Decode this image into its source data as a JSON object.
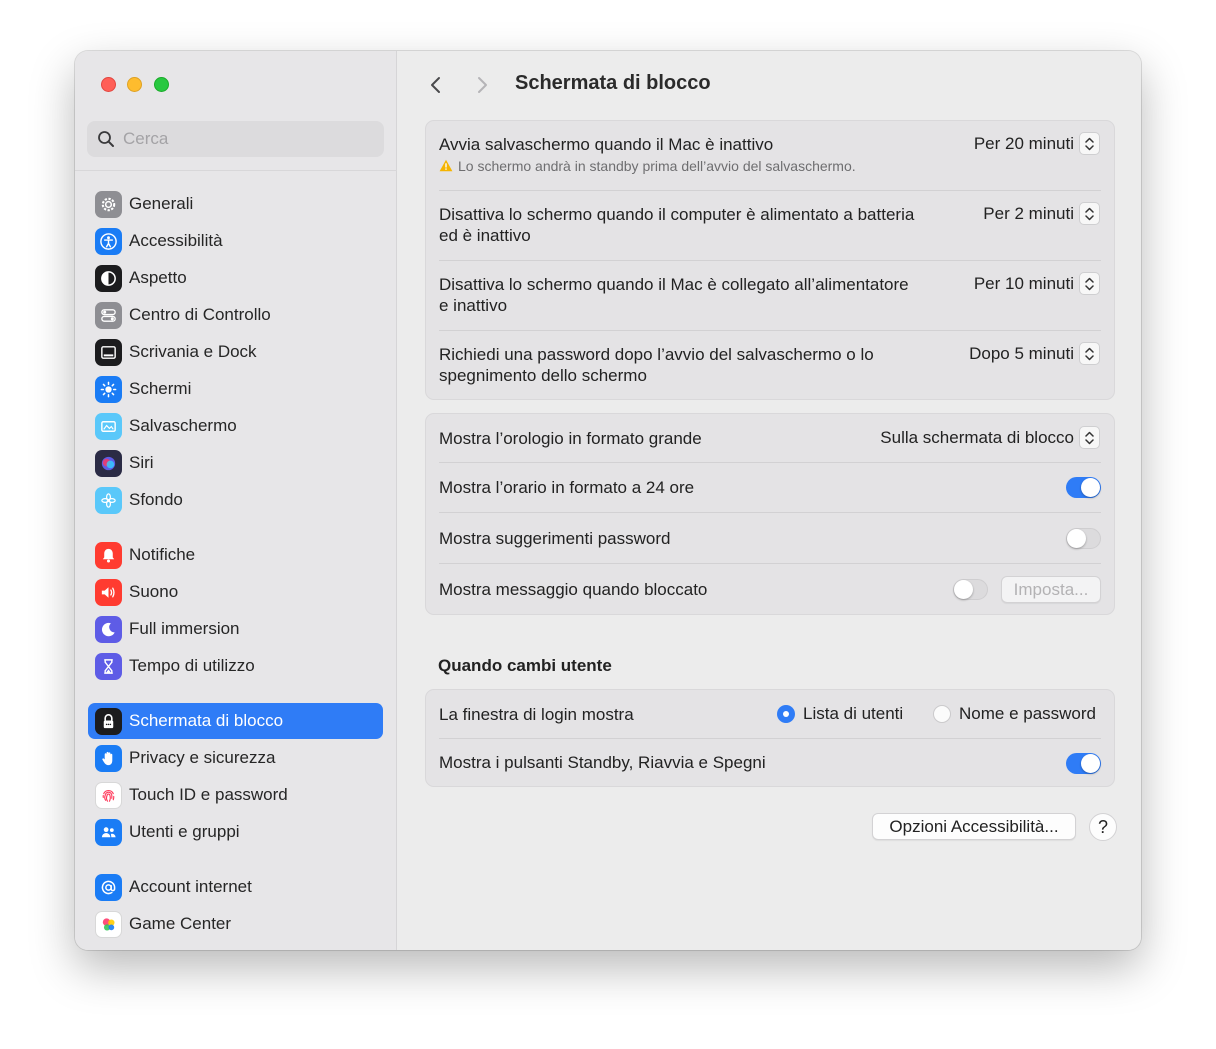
{
  "window": {
    "title": "Schermata di blocco"
  },
  "search": {
    "placeholder": "Cerca"
  },
  "sidebar": {
    "items": [
      {
        "label": "Generali",
        "icon": "gear-icon",
        "color": "#8e8e93"
      },
      {
        "label": "Accessibilità",
        "icon": "accessibility-icon",
        "color": "#1a7cf5"
      },
      {
        "label": "Aspetto",
        "icon": "appearance-icon",
        "color": "#1c1c1e"
      },
      {
        "label": "Centro di Controllo",
        "icon": "control-center-icon",
        "color": "#8e8e93"
      },
      {
        "label": "Scrivania e Dock",
        "icon": "dock-icon",
        "color": "#1c1c1e"
      },
      {
        "label": "Schermi",
        "icon": "sun-icon",
        "color": "#1a7cf5"
      },
      {
        "label": "Salvaschermo",
        "icon": "screensaver-icon",
        "color": "#5ac8fa"
      },
      {
        "label": "Siri",
        "icon": "siri-icon",
        "color": "#2b2b45"
      },
      {
        "label": "Sfondo",
        "icon": "wallpaper-icon",
        "color": "#5ac8fa"
      },
      {
        "label": "Notifiche",
        "icon": "bell-icon",
        "color": "#ff3b30"
      },
      {
        "label": "Suono",
        "icon": "speaker-icon",
        "color": "#ff3b30"
      },
      {
        "label": "Full immersion",
        "icon": "moon-icon",
        "color": "#5e5ce6"
      },
      {
        "label": "Tempo di utilizzo",
        "icon": "hourglass-icon",
        "color": "#5e5ce6"
      },
      {
        "label": "Schermata di blocco",
        "icon": "lock-icon",
        "color": "#1c1c1e",
        "active": true
      },
      {
        "label": "Privacy e sicurezza",
        "icon": "hand-icon",
        "color": "#1a7cf5"
      },
      {
        "label": "Touch ID e password",
        "icon": "fingerprint-icon",
        "color": "#ffffff"
      },
      {
        "label": "Utenti e gruppi",
        "icon": "users-icon",
        "color": "#1a7cf5"
      },
      {
        "label": "Account internet",
        "icon": "at-icon",
        "color": "#1a7cf5"
      },
      {
        "label": "Game Center",
        "icon": "game-center-icon",
        "color": "#ffffff"
      }
    ]
  },
  "group1": {
    "rows": [
      {
        "label": "Avvia salvaschermo quando il Mac è inattivo",
        "sub": "Lo schermo andrà in standby prima dell’avvio del salvaschermo.",
        "value": "Per 20 minuti"
      },
      {
        "label_line1": "Disattiva lo schermo quando il computer è alimentato a batteria",
        "label_line2": "ed è inattivo",
        "value": "Per 2 minuti"
      },
      {
        "label_line1": "Disattiva lo schermo quando il Mac è collegato all’alimentatore",
        "label_line2": "e inattivo",
        "value": "Per 10 minuti"
      },
      {
        "label_line1": "Richiedi una password dopo l’avvio del salvaschermo o lo",
        "label_line2": "spegnimento dello schermo",
        "value": "Dopo 5 minuti"
      }
    ]
  },
  "group2": {
    "clock_label": "Mostra l’orologio in formato grande",
    "clock_value": "Sulla schermata di blocco",
    "time24_label": "Mostra l’orario in formato a 24 ore",
    "time24_on": true,
    "hints_label": "Mostra suggerimenti password",
    "hints_on": false,
    "message_label": "Mostra messaggio quando bloccato",
    "message_on": false,
    "message_button": "Imposta..."
  },
  "switch_user": {
    "title": "Quando cambi utente",
    "login_label": "La finestra di login mostra",
    "option_list": "Lista di utenti",
    "option_name": "Nome e password",
    "selected": "Lista di utenti",
    "buttons_label": "Mostra i pulsanti Standby, Riavvia e Spegni",
    "buttons_on": true
  },
  "footer": {
    "accessibility_button": "Opzioni Accessibilità...",
    "help_label": "?"
  },
  "colors": {
    "accent": "#2f7cf6",
    "warning": "#f5b400"
  }
}
